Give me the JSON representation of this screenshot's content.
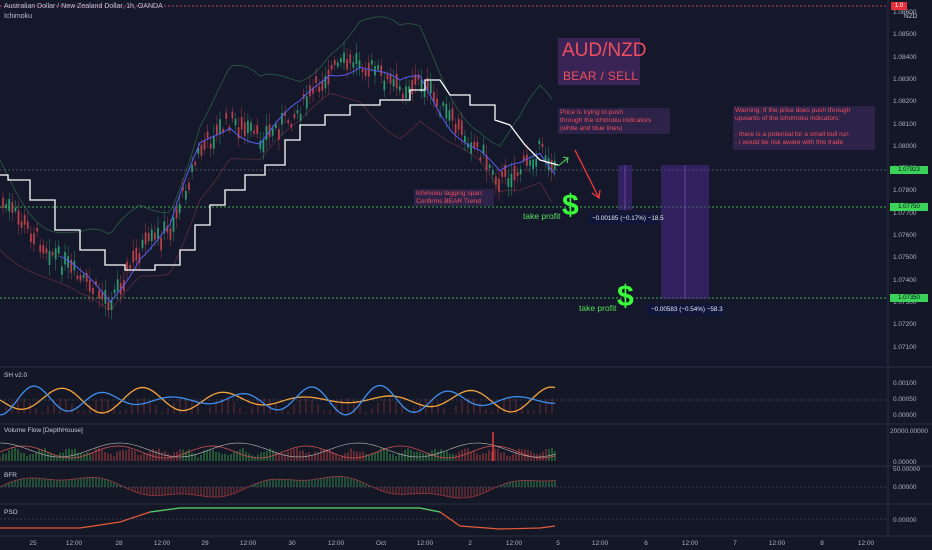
{
  "header": {
    "symbol_line": "Australian Dollar / New Zealand Dollar, 1h, OANDA",
    "indicator": "Ichimoku"
  },
  "currency": "NZD",
  "price_axis": {
    "labels": [
      "1.08600",
      "1.08500",
      "1.08400",
      "1.08300",
      "1.08200",
      "1.08100",
      "1.08000",
      "1.07900",
      "1.07800",
      "1.07700",
      "1.07600",
      "1.07500",
      "1.07400",
      "1.07300",
      "1.07200",
      "1.07100"
    ],
    "tags": {
      "top": "1.0",
      "current": "1.07923",
      "tp1": "1.07750",
      "tp2": "1.07350"
    }
  },
  "annotations": {
    "title": "AUD/NZD",
    "subtitle": "BEAR / SELL",
    "note_push": "Price is trying to push\nthrough the ichimoku indicators\n(white and blue lines)",
    "note_lagging": "Ichimoku lagging span:\nConfirms BEAR Trend",
    "warning": "Warning: If the price does push through\nupwards of the ichomoku indicators:\n\n- there is a potential for a small bull run\n- i would be risk aware with this trade",
    "take_profit_1": "take profit",
    "take_profit_2": "take profit",
    "dollar_sign": "$",
    "measure_1": "−0.00185 (−0.17%) −18.5",
    "measure_2": "−0.00583 (−0.54%) −58.3"
  },
  "panes": {
    "sh": {
      "title": "SH v2.0",
      "labels": [
        "0.00100",
        "0.00050",
        "0.00000"
      ]
    },
    "volume": {
      "title": "Volume Flow [DepthHouse]",
      "labels": [
        "20000.00000",
        "0.00000"
      ]
    },
    "bfr": {
      "title": "BFR",
      "labels": [
        "50.00000",
        "0.00000"
      ]
    },
    "pso": {
      "title": "PSO",
      "labels": [
        "0.00000"
      ]
    }
  },
  "time_axis": [
    "25",
    "12:00",
    "28",
    "12:00",
    "29",
    "12:00",
    "30",
    "12:00",
    "Oct",
    "12:00",
    "2",
    "12:00",
    "5",
    "12:00",
    "6",
    "12:00",
    "7",
    "12:00",
    "8",
    "12:00"
  ],
  "colors": {
    "background": "#141826",
    "bear_red": "#ef4f5f",
    "take_profit_green": "#56e05a",
    "white_line": "#ffffff",
    "blue_line": "#5b5cf0",
    "orange_osc": "#f7a43a",
    "blue_osc": "#3f8ff0"
  }
}
